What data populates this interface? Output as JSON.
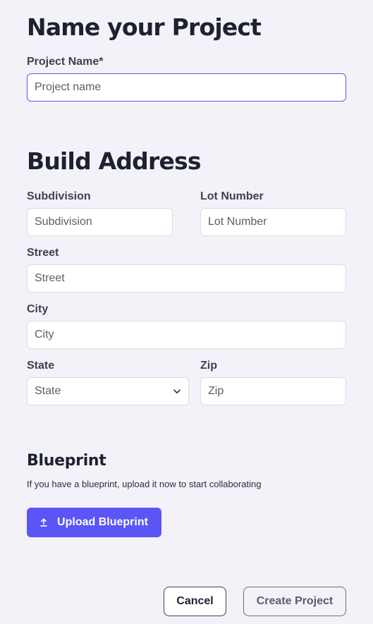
{
  "project": {
    "title": "Name your Project",
    "name_label": "Project Name*",
    "name_placeholder": "Project name"
  },
  "address": {
    "title": "Build Address",
    "subdivision_label": "Subdivision",
    "subdivision_placeholder": "Subdivision",
    "lot_label": "Lot Number",
    "lot_placeholder": "Lot Number",
    "street_label": "Street",
    "street_placeholder": "Street",
    "city_label": "City",
    "city_placeholder": "City",
    "state_label": "State",
    "state_selected": "State",
    "zip_label": "Zip",
    "zip_placeholder": "Zip"
  },
  "blueprint": {
    "title": "Blueprint",
    "helper": "If you have a blueprint, upload it now to start collaborating",
    "upload_label": "Upload Blueprint",
    "upload_icon": "upload-icon"
  },
  "actions": {
    "cancel_label": "Cancel",
    "create_label": "Create Project"
  },
  "colors": {
    "accent": "#5b55f6",
    "focus_border": "#5a5fe0",
    "background": "#f2f2f8"
  }
}
